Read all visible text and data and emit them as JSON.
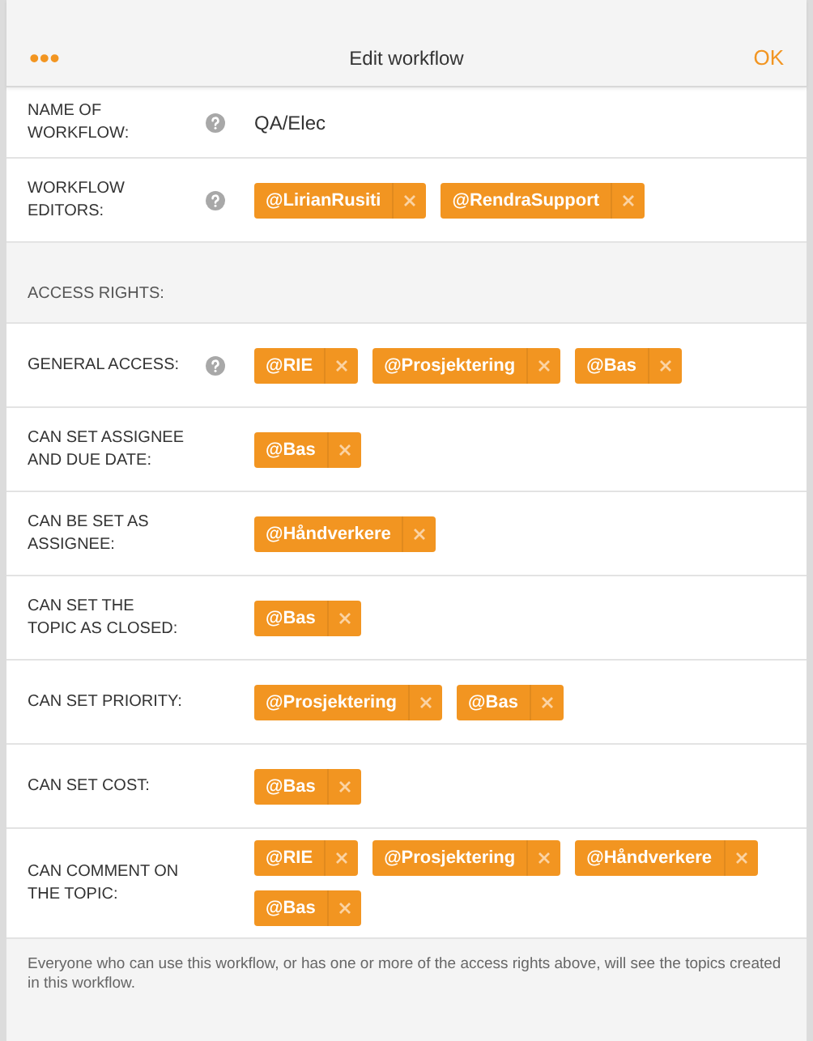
{
  "header": {
    "menu": "•••",
    "title": "Edit workflow",
    "ok": "OK"
  },
  "top_rows": [
    {
      "label": "NAME OF WORKFLOW:",
      "help": true,
      "kind": "text",
      "value": "QA/Elec"
    },
    {
      "label": "WORKFLOW EDITORS:",
      "help": true,
      "kind": "tags",
      "tags": [
        "@LirianRusiti",
        "@RendraSupport"
      ]
    }
  ],
  "section_title": "ACCESS RIGHTS:",
  "access_rows": [
    {
      "label": "GENERAL ACCESS:",
      "help": true,
      "tags": [
        "@RIE",
        "@Prosjektering",
        "@Bas"
      ]
    },
    {
      "label": "CAN SET ASSIGNEE AND DUE DATE:",
      "help": false,
      "tags": [
        "@Bas"
      ]
    },
    {
      "label": "CAN BE SET AS ASSIGNEE:",
      "help": false,
      "tags": [
        "@Håndverkere"
      ]
    },
    {
      "label": "CAN SET THE TOPIC AS CLOSED:",
      "help": false,
      "tags": [
        "@Bas"
      ]
    },
    {
      "label": "CAN SET PRIORITY:",
      "help": false,
      "tags": [
        "@Prosjektering",
        "@Bas"
      ]
    },
    {
      "label": "CAN SET COST:",
      "help": false,
      "tags": [
        "@Bas"
      ]
    },
    {
      "label": "CAN COMMENT ON THE TOPIC:",
      "help": false,
      "tags": [
        "@RIE",
        "@Prosjektering",
        "@Håndverkere",
        "@Bas"
      ]
    }
  ],
  "footer_note": "Everyone who can use this workflow, or has one or more of the access rights above, will see the topics created in this workflow."
}
